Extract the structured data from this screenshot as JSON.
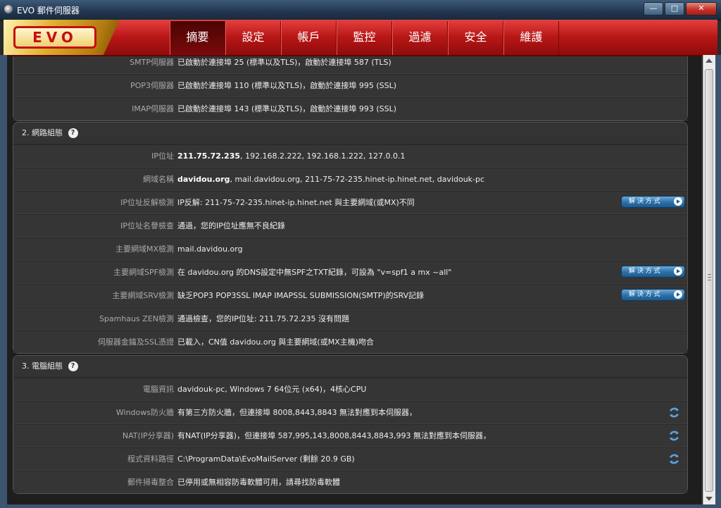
{
  "window": {
    "title": "EVO 郵件伺服器",
    "minimize": "—",
    "maximize": "□",
    "close": "✕"
  },
  "brand": {
    "logo_text": "EVO"
  },
  "nav": {
    "items": [
      {
        "label": "摘要"
      },
      {
        "label": "設定"
      },
      {
        "label": "帳戶"
      },
      {
        "label": "監控"
      },
      {
        "label": "過濾"
      },
      {
        "label": "安全"
      },
      {
        "label": "維護"
      }
    ],
    "active_index": 0
  },
  "section1": {
    "rows": [
      {
        "label": "SMTP伺服器",
        "value": "已啟動於連接埠 25 (標準以及TLS)，啟動於連接埠 587 (TLS)"
      },
      {
        "label": "POP3伺服器",
        "value": "已啟動於連接埠 110 (標準以及TLS)，啟動於連接埠 995 (SSL)"
      },
      {
        "label": "IMAP伺服器",
        "value": "已啟動於連接埠 143 (標準以及TLS)，啟動於連接埠 993 (SSL)"
      }
    ]
  },
  "section2": {
    "title": "2. 網路組態",
    "help": "?",
    "fix_label": "解 決 方 式",
    "rows": [
      {
        "label": "IP位址",
        "bold": "211.75.72.235",
        "value": ", 192.168.2.222, 192.168.1.222, 127.0.0.1"
      },
      {
        "label": "網域名稱",
        "bold": "davidou.org",
        "value": ", mail.davidou.org, 211-75-72-235.hinet-ip.hinet.net, davidouk-pc"
      },
      {
        "label": "IP位址反解檢測",
        "bold": "",
        "value": "IP反解: 211-75-72-235.hinet-ip.hinet.net 與主要網域(或MX)不同"
      },
      {
        "label": "IP位址名譽檢查",
        "bold": "",
        "value": "通過，您的IP位址應無不良紀錄"
      },
      {
        "label": "主要網域MX檢測",
        "bold": "",
        "value": "mail.davidou.org"
      },
      {
        "label": "主要網域SPF檢測",
        "bold": "",
        "value": "在 davidou.org 的DNS設定中無SPF之TXT紀錄，可設為 \"v=spf1 a mx ~all\""
      },
      {
        "label": "主要網域SRV檢測",
        "bold": "",
        "value": "缺乏POP3 POP3SSL IMAP IMAPSSL SUBMISSION(SMTP)的SRV記錄"
      },
      {
        "label": "Spamhaus ZEN檢測",
        "bold": "",
        "value": "通過檢查，您的IP位址: 211.75.72.235 沒有問題"
      },
      {
        "label": "伺服器金鑰及SSL憑證",
        "bold": "",
        "value": "已載入，CN值 davidou.org 與主要網域(或MX主機)吻合"
      }
    ]
  },
  "section3": {
    "title": "3. 電腦組態",
    "help": "?",
    "rows": [
      {
        "label": "電腦資訊",
        "value": "davidouk-pc, Windows 7 64位元 (x64)，4核心CPU"
      },
      {
        "label": "Windows防火牆",
        "value": "有第三方防火牆，但連接埠 8008,8443,8843 無法對應到本伺服器，"
      },
      {
        "label": "NAT(IP分享器)",
        "value": "有NAT(IP分享器)，但連接埠 587,995,143,8008,8443,8843,993 無法對應到本伺服器，"
      },
      {
        "label": "程式資料路徑",
        "value": "C:\\ProgramData\\EvoMailServer (剩餘 20.9 GB)"
      },
      {
        "label": "郵件掃毒整合",
        "value": "已停用或無相容防毒軟體可用，請尋找防毒軟體"
      }
    ]
  },
  "colors": {
    "header_red": "#b81616",
    "button_blue": "#2a6fa8",
    "panel": "#333333"
  }
}
